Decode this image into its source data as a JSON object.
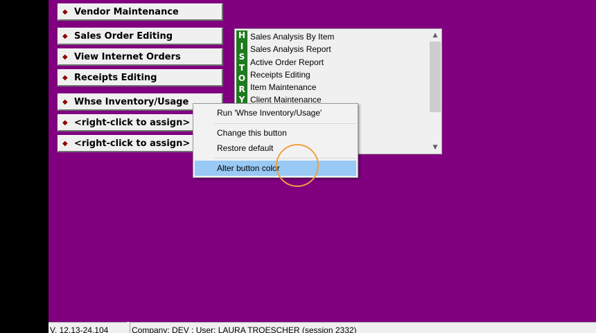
{
  "buttons": [
    {
      "label": "Vendor Maintenance"
    },
    {
      "label": "Sales Order Editing"
    },
    {
      "label": "View Internet Orders"
    },
    {
      "label": "Receipts Editing"
    },
    {
      "label": "Whse Inventory/Usage"
    },
    {
      "label": "<right-click to assign>"
    },
    {
      "label": "<right-click to assign>"
    }
  ],
  "history": {
    "tab_letters": [
      "H",
      "I",
      "S",
      "T",
      "O",
      "R",
      "Y"
    ],
    "items": [
      "Sales Analysis By Item",
      "Sales Analysis Report",
      "Active Order Report",
      "Receipts Editing",
      "Item Maintenance",
      "Client Maintenance"
    ]
  },
  "context_menu": {
    "items": [
      "Run 'Whse Inventory/Usage'",
      "Change this button",
      "Restore default",
      "Alter button color"
    ],
    "highlighted_index": 3
  },
  "status": {
    "version": "V. 12.13-24.104",
    "company": "Company: DEV : User: LAURA TROESCHER (session 2332)"
  },
  "colors": {
    "background": "#800080",
    "history_tab": "#1f7a1f",
    "menu_highlight": "#99c9f5",
    "cursor_ring": "#f0a040"
  }
}
